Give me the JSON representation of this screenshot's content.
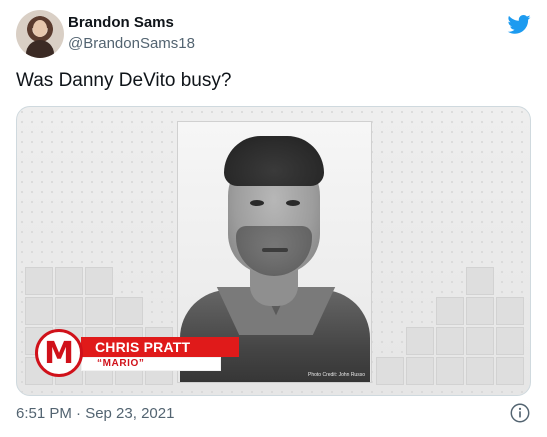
{
  "tweet": {
    "author": {
      "display_name": "Brandon Sams",
      "handle": "@BrandonSams18",
      "avatar_icon": "user-avatar"
    },
    "platform_icon": "twitter-bird-icon",
    "text": "Was Danny DeVito busy?",
    "media": {
      "lower_third": {
        "badge_letter": "M",
        "name": "CHRIS PRATT",
        "role": "“MARIO”"
      },
      "photo_credit": "Photo Credit: John Russo"
    },
    "timestamp": "6:51 PM · Sep 23, 2021",
    "info_icon": "info-icon"
  },
  "colors": {
    "twitter_blue": "#1d9bf0",
    "mario_red": "#e01a1a",
    "secondary_text": "#536471"
  }
}
